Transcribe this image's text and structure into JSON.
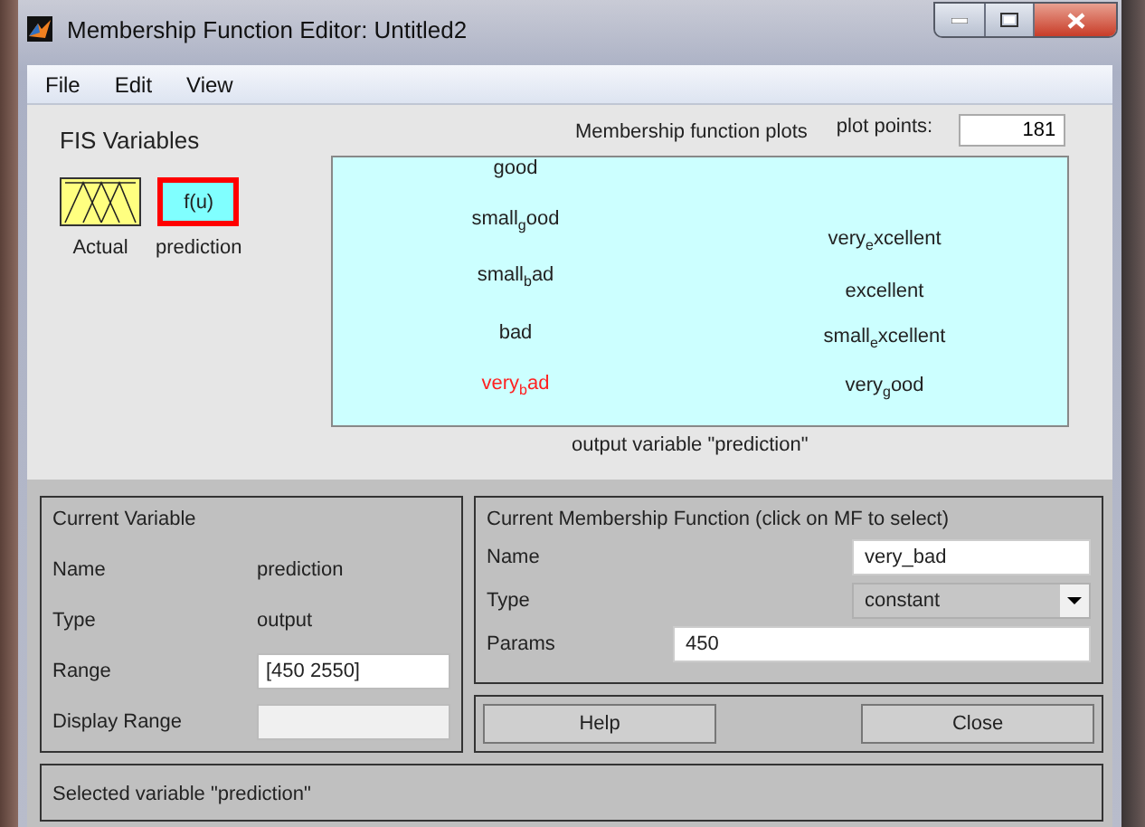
{
  "window": {
    "title": "Membership Function Editor: Untitled2"
  },
  "menu": [
    "File",
    "Edit",
    "View"
  ],
  "fis_variables": {
    "title": "FIS Variables",
    "items": [
      {
        "label": "Actual",
        "kind": "input",
        "selected": false
      },
      {
        "label": "prediction",
        "kind": "output",
        "icon_text": "f(u)",
        "selected": true
      }
    ]
  },
  "plot": {
    "title": "Membership function plots",
    "plot_points_label": "plot points:",
    "plot_points": "181",
    "caption": "output variable \"prediction\"",
    "columns": [
      [
        {
          "label": "good",
          "selected": false
        },
        {
          "label": "small$_{g}$ood",
          "selected": false
        },
        {
          "label": "small$_{b}$ad",
          "selected": false
        },
        {
          "label": "bad",
          "selected": false
        },
        {
          "label": "very$_{b}$ad",
          "selected": true
        }
      ],
      [
        {
          "label": "very$_{e}$xcellent",
          "selected": false
        },
        {
          "label": "excellent",
          "selected": false
        },
        {
          "label": "small$_{e}$xcellent",
          "selected": false
        },
        {
          "label": "very$_{g}$ood",
          "selected": false
        }
      ]
    ]
  },
  "current_variable": {
    "title": "Current Variable",
    "rows": [
      {
        "label": "Name",
        "kind": "text",
        "value": "prediction"
      },
      {
        "label": "Type",
        "kind": "text",
        "value": "output"
      },
      {
        "label": "Range",
        "kind": "field",
        "value": "[450 2550]",
        "disabled": false
      },
      {
        "label": "Display Range",
        "kind": "field",
        "disabled": true
      }
    ]
  },
  "current_mf": {
    "title": "Current Membership Function (click on MF to select)",
    "name_label": "Name",
    "name": "very_bad",
    "type_label": "Type",
    "type": "constant",
    "params_label": "Params",
    "params": "450"
  },
  "buttons": [
    "Help",
    "Close"
  ],
  "status": "Selected variable \"prediction\""
}
